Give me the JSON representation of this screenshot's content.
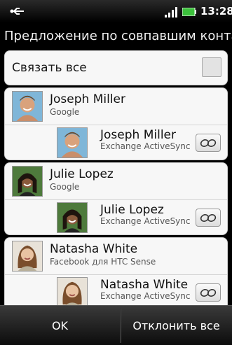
{
  "status_bar": {
    "time": "13:28",
    "icons": [
      "usb-icon",
      "signal-icon",
      "battery-icon"
    ]
  },
  "header": {
    "title": "Предложение по совпавшим конта"
  },
  "link_all": {
    "label": "Связать все",
    "checked": false
  },
  "groups": [
    {
      "primary": {
        "name": "Joseph Miller",
        "source": "Google"
      },
      "match": {
        "name": "Joseph Miller",
        "source": "Exchange ActiveSync"
      }
    },
    {
      "primary": {
        "name": "Julie Lopez",
        "source": "Google"
      },
      "match": {
        "name": "Julie Lopez",
        "source": "Exchange ActiveSync"
      }
    },
    {
      "primary": {
        "name": "Natasha White",
        "source": "Facebook для HTC Sense"
      },
      "match": {
        "name": "Natasha White",
        "source": "Exchange ActiveSync"
      }
    }
  ],
  "bottom_bar": {
    "ok_label": "OK",
    "decline_label": "Отклонить все"
  },
  "colors": {
    "background": "#000000",
    "card": "#f7f7f7",
    "bottom_bar": "#2a2a2a"
  }
}
